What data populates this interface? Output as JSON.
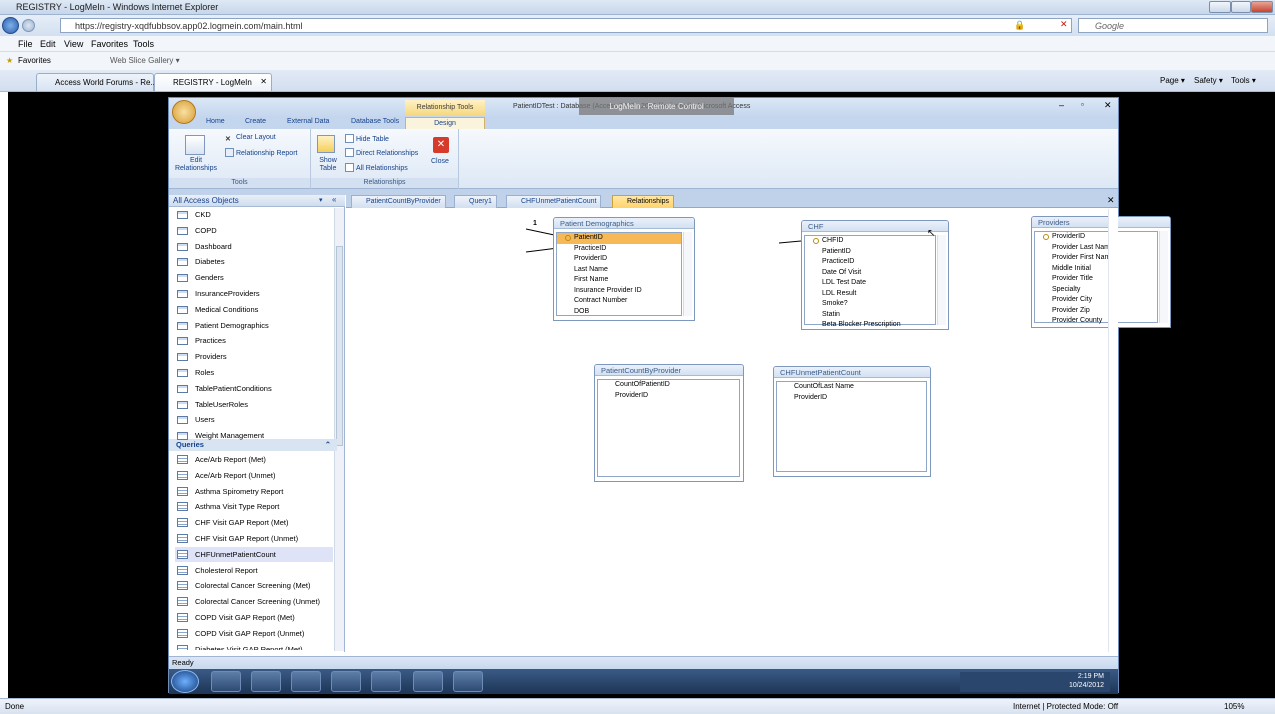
{
  "browser": {
    "window_title": "REGISTRY - LogMeIn - Windows Internet Explorer",
    "url": "https://registry-xqdfubbsov.app02.logmein.com/main.html",
    "search_placeholder": "Google",
    "menu": [
      "File",
      "Edit",
      "View",
      "Favorites",
      "Tools"
    ],
    "favorites_bar": {
      "favorites_label": "Favorites",
      "web_slice_label": "Web Slice Gallery ▾"
    },
    "tabs": [
      {
        "label": "Access World Forums - Re..."
      },
      {
        "label": "REGISTRY - LogMeIn"
      }
    ],
    "commands": {
      "page": "Page ▾",
      "safety": "Safety ▾",
      "tools": "Tools ▾"
    },
    "status_left": "Done",
    "status_zone": "Internet | Protected Mode: Off",
    "zoom": "105%"
  },
  "access": {
    "title": "PatientIDTest : Database (Access 2002 - 2003 file format) - Microsoft Access",
    "context_tab": "Relationship Tools",
    "logmein_overlay": "LogMeIn - Remote Control",
    "ribbon_tabs": [
      "Home",
      "Create",
      "External Data",
      "Database Tools",
      "Design"
    ],
    "ribbon": {
      "edit_relationships": "Edit Relationships",
      "clear_layout": "Clear Layout",
      "relationship_report": "Relationship Report",
      "tools_group": "Tools",
      "show_table": "Show Table",
      "hide_table": "Hide Table",
      "direct_relationships": "Direct Relationships",
      "all_relationships": "All Relationships",
      "close": "Close",
      "relationships_group": "Relationships"
    },
    "nav": {
      "header": "All Access Objects",
      "tables": [
        "CKD",
        "COPD",
        "Dashboard",
        "Diabetes",
        "Genders",
        "InsuranceProviders",
        "Medical Conditions",
        "Patient Demographics",
        "Practices",
        "Providers",
        "Roles",
        "TablePatientConditions",
        "TableUserRoles",
        "Users",
        "Weight Management"
      ],
      "queries_label": "Queries",
      "queries": [
        "Ace/Arb Report (Met)",
        "Ace/Arb Report (Unmet)",
        "Asthma Spirometry Report",
        "Asthma Visit Type Report",
        "CHF Visit GAP Report (Met)",
        "CHF Visit GAP Report (Unmet)",
        "CHFUnmetPatientCount",
        "Cholesterol Report",
        "Colorectal Cancer Screening (Met)",
        "Colorectal Cancer Screening (Unmet)",
        "COPD Visit GAP Report (Met)",
        "COPD Visit GAP Report (Unmet)",
        "Diabetes Visit GAP Report (Met)"
      ],
      "selected_query": "CHFUnmetPatientCount"
    },
    "doc_tabs": [
      "PatientCountByProvider",
      "Query1",
      "CHFUnmetPatientCount",
      "Relationships"
    ],
    "tables": {
      "patient_demographics": {
        "title": "Patient Demographics",
        "fields": [
          "PatientID",
          "PracticeID",
          "ProviderID",
          "Last Name",
          "First Name",
          "Insurance Provider ID",
          "Contract Number",
          "DOB"
        ]
      },
      "chf": {
        "title": "CHF",
        "fields": [
          "CHFID",
          "PatientID",
          "PracticeID",
          "Date Of Visit",
          "LDL Test Date",
          "LDL Result",
          "Smoke?",
          "Statin",
          "Beta Blocker Prescription"
        ]
      },
      "providers": {
        "title": "Providers",
        "fields": [
          "ProviderID",
          "Provider Last Name",
          "Provider First Name",
          "Middle Initial",
          "Provider Title",
          "Specialty",
          "Provider City",
          "Provider Zip",
          "Provider County"
        ]
      },
      "patient_count_by_provider": {
        "title": "PatientCountByProvider",
        "fields": [
          "CountOfPatientID",
          "ProviderID"
        ]
      },
      "chf_unmet_patient_count": {
        "title": "CHFUnmetPatientCount",
        "fields": [
          "CountOfLast Name",
          "ProviderID"
        ]
      }
    },
    "relationship_labels": {
      "one": "1",
      "many": "∞"
    },
    "status": "Ready"
  },
  "taskbar": {
    "time": "2:19 PM",
    "date": "10/24/2012"
  }
}
